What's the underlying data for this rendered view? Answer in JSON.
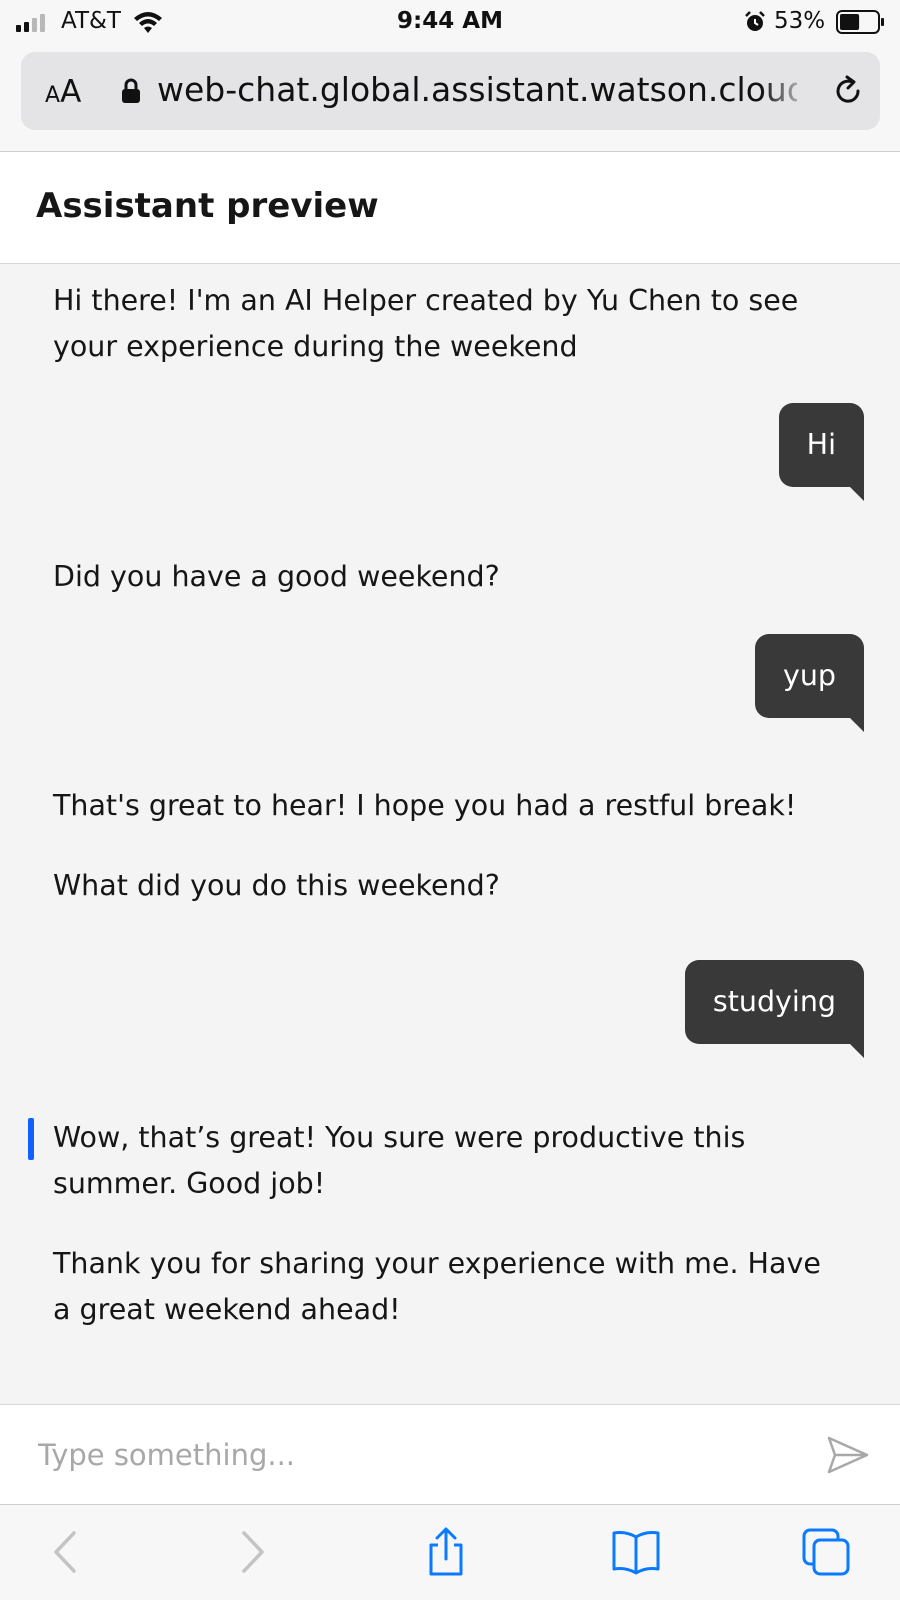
{
  "status_bar": {
    "carrier": "AT&T",
    "time": "9:44 AM",
    "battery_percent": "53%",
    "signal_bars_active": 2,
    "signal_bars_total": 4,
    "battery_level": 0.53
  },
  "browser": {
    "text_size_label_small": "A",
    "text_size_label_large": "A",
    "url": "web-chat.global.assistant.watson.cloud"
  },
  "chat": {
    "title": "Assistant preview",
    "messages": [
      {
        "from": "bot",
        "paragraphs": [
          "Hi there! I'm an AI Helper created by Yu Chen to see your experience during the weekend"
        ]
      },
      {
        "from": "user",
        "text": "Hi"
      },
      {
        "from": "bot",
        "paragraphs": [
          "Did you have a good weekend?"
        ]
      },
      {
        "from": "user",
        "text": "yup"
      },
      {
        "from": "bot",
        "paragraphs": [
          "That's great to hear! I hope you had a restful break!",
          "What did you do this weekend?"
        ]
      },
      {
        "from": "user",
        "text": "studying"
      },
      {
        "from": "bot",
        "paragraphs": [
          "Wow, that’s great! You sure were productive this summer. Good job!",
          "Thank you for sharing your experience with me. Have a great weekend ahead!"
        ]
      }
    ],
    "input_placeholder": "Type something...",
    "accent_color": "#0f62fe",
    "user_bubble_color": "#393939"
  },
  "toolbar": {
    "icons": [
      "back-icon",
      "forward-icon",
      "share-icon",
      "bookmarks-icon",
      "tabs-icon"
    ]
  }
}
